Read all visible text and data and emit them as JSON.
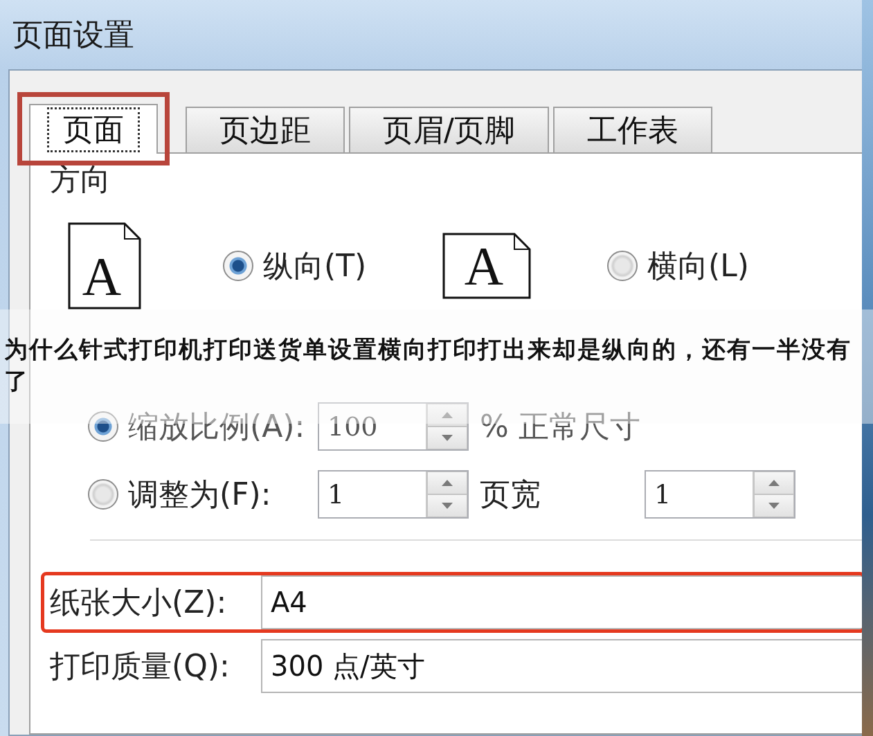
{
  "window": {
    "title": "页面设置"
  },
  "tabs": [
    {
      "label": "页面",
      "selected": true,
      "highlighted": true
    },
    {
      "label": "页边距",
      "selected": false,
      "highlighted": false
    },
    {
      "label": "页眉/页脚",
      "selected": false,
      "highlighted": false
    },
    {
      "label": "工作表",
      "selected": false,
      "highlighted": false
    }
  ],
  "orientation": {
    "heading": "方向",
    "options": [
      {
        "kind": "portrait",
        "icon_letter": "A",
        "label": "纵向(T)",
        "selected": true
      },
      {
        "kind": "landscape",
        "icon_letter": "A",
        "label": "横向(L)",
        "selected": false
      }
    ]
  },
  "scaling": {
    "options": [
      {
        "label": "缩放比例(A):",
        "selected": true,
        "disabled": true,
        "fields": [
          {
            "value": "100",
            "unit": "% 正常尺寸"
          }
        ]
      },
      {
        "label": "调整为(F):",
        "selected": false,
        "disabled": false,
        "fields": [
          {
            "value": "1",
            "unit": "页宽"
          },
          {
            "value": "1"
          }
        ]
      }
    ]
  },
  "settings": [
    {
      "label": "纸张大小(Z):",
      "value": "A4",
      "highlighted": true
    },
    {
      "label": "打印质量(Q):",
      "value": "300 点/英寸",
      "highlighted": false
    }
  ],
  "caption": "为什么针式打印机打印送货单设置横向打印打出来却是纵向的，还有一半没有了"
}
